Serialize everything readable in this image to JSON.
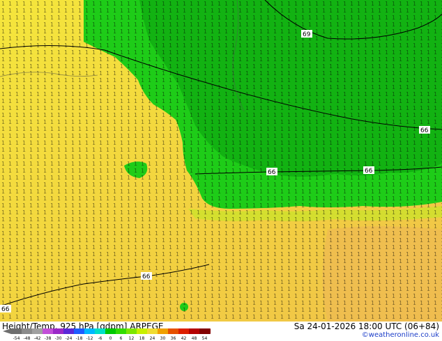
{
  "footer": {
    "title": "Height/Temp. 925 hPa [gdpm] ARPEGE",
    "datetime": "Sa 24-01-2026 18:00 UTC (06+84)",
    "credit": "©weatheronline.co.uk"
  },
  "colorbar": {
    "ticks": [
      "-54",
      "-48",
      "-42",
      "-38",
      "-30",
      "-24",
      "-18",
      "-12",
      "-6",
      "0",
      "6",
      "12",
      "18",
      "24",
      "30",
      "36",
      "42",
      "48",
      "54"
    ],
    "colors": [
      "#6e6e6e",
      "#8a8a8a",
      "#a0a0a0",
      "#c24fd8",
      "#9a28c8",
      "#5a28d8",
      "#1e5cff",
      "#00b8ff",
      "#00e0c8",
      "#00c800",
      "#32dc00",
      "#7ce600",
      "#c8f000",
      "#f0dc32",
      "#f0a000",
      "#e65000",
      "#dc1e00",
      "#b40000",
      "#820000"
    ]
  },
  "contour_labels": [
    {
      "text": "69"
    },
    {
      "text": "66"
    },
    {
      "text": "66"
    },
    {
      "text": "66"
    },
    {
      "text": "66"
    },
    {
      "text": "66"
    }
  ],
  "colors": {
    "dark_green": "#10b810",
    "mid_green": "#1ecc18",
    "yellow_green": "#e8e61e",
    "yellow": "#f5dc3c",
    "orange_yellow": "#f2c846"
  }
}
